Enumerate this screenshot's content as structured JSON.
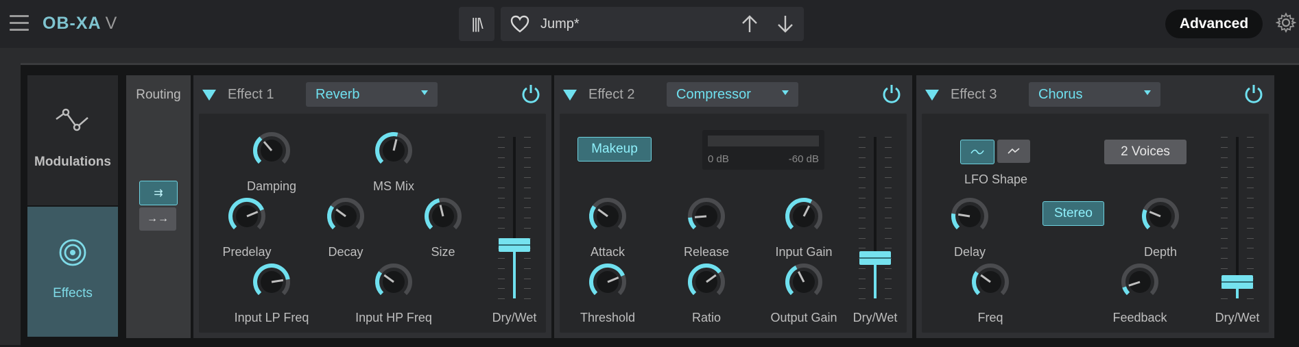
{
  "app": {
    "logo": "OB-XA",
    "logo_version": "V"
  },
  "topbar": {
    "library_icon_text": "|||\\",
    "preset_name": "Jump*",
    "advanced_label": "Advanced"
  },
  "nav": {
    "modulations": "Modulations",
    "effects": "Effects"
  },
  "routing": {
    "label": "Routing",
    "parallel_symbol": "⇉",
    "serial_symbol": "→→"
  },
  "effects": [
    {
      "title": "Effect 1",
      "type": "Reverb",
      "knobs": [
        {
          "label": "Damping",
          "value": 0.35
        },
        {
          "label": "MS Mix",
          "value": 0.55
        },
        {
          "label": "Predelay",
          "value": 0.75
        },
        {
          "label": "Decay",
          "value": 0.3
        },
        {
          "label": "Size",
          "value": 0.45
        },
        {
          "label": "Input LP Freq",
          "value": 0.8
        },
        {
          "label": "Input HP Freq",
          "value": 0.3
        }
      ],
      "fader": {
        "label": "Dry/Wet",
        "value": 0.33
      }
    },
    {
      "title": "Effect 2",
      "type": "Compressor",
      "makeup_label": "Makeup",
      "meter": {
        "left": "0 dB",
        "right": "-60 dB"
      },
      "knobs": [
        {
          "label": "Attack",
          "value": 0.3
        },
        {
          "label": "Release",
          "value": 0.15
        },
        {
          "label": "Input Gain",
          "value": 0.6
        },
        {
          "label": "Threshold",
          "value": 0.75
        },
        {
          "label": "Ratio",
          "value": 0.7
        },
        {
          "label": "Output Gain",
          "value": 0.4
        }
      ],
      "fader": {
        "label": "Dry/Wet",
        "value": 0.25
      }
    },
    {
      "title": "Effect 3",
      "type": "Chorus",
      "lfo_label": "LFO Shape",
      "voices_label": "2 Voices",
      "stereo_label": "Stereo",
      "knobs": [
        {
          "label": "Delay",
          "value": 0.2
        },
        {
          "label": "Depth",
          "value": 0.25
        },
        {
          "label": "Freq",
          "value": 0.3
        },
        {
          "label": "Feedback",
          "value": 0.1
        }
      ],
      "fader": {
        "label": "Dry/Wet",
        "value": 0.1
      }
    }
  ],
  "colors": {
    "accent": "#6fe0ef",
    "panel": "#2f3033",
    "knob_track": "#4a4b4e"
  }
}
